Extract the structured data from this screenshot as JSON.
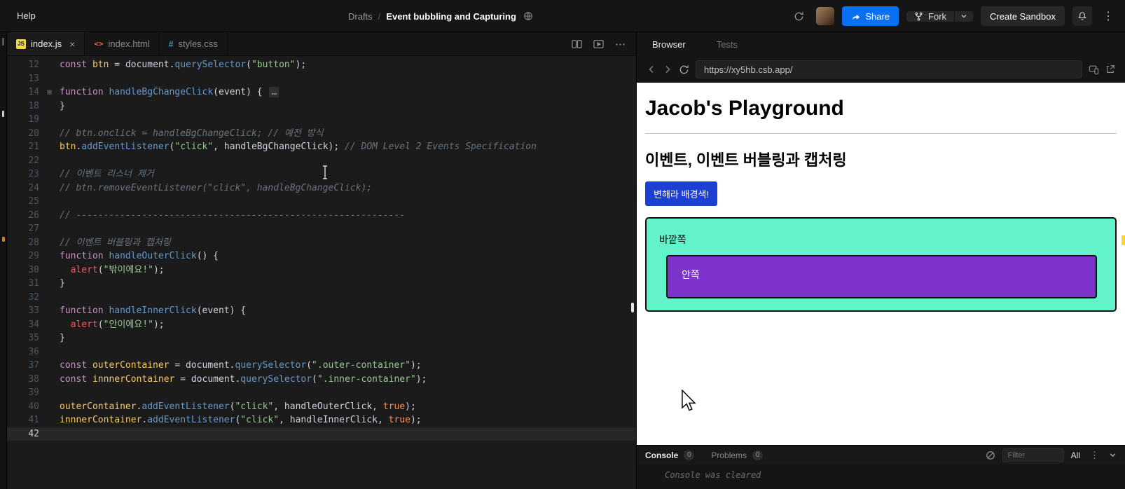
{
  "header": {
    "help_label": "Help",
    "breadcrumb": {
      "folder": "Drafts",
      "separator": "/",
      "title": "Event bubbling and Capturing"
    },
    "share_label": "Share",
    "fork_label": "Fork",
    "create_sandbox_label": "Create Sandbox"
  },
  "editor": {
    "tabs": [
      {
        "label": "index.js",
        "active": true
      },
      {
        "label": "index.html",
        "active": false
      },
      {
        "label": "styles.css",
        "active": false
      }
    ],
    "lines": [
      {
        "n": 12,
        "tokens": [
          [
            "k",
            "const"
          ],
          [
            "pl",
            " "
          ],
          [
            "v",
            "btn"
          ],
          [
            "pl",
            " = "
          ],
          [
            "pl",
            "document"
          ],
          [
            "pl",
            "."
          ],
          [
            "f",
            "querySelector"
          ],
          [
            "pl",
            "("
          ],
          [
            "s",
            "\"button\""
          ],
          [
            "pl",
            ");"
          ]
        ]
      },
      {
        "n": 13,
        "tokens": []
      },
      {
        "n": 14,
        "fold": true,
        "tokens": [
          [
            "k",
            "function"
          ],
          [
            "pl",
            " "
          ],
          [
            "f",
            "handleBgChangeClick"
          ],
          [
            "pl",
            "(event) { "
          ],
          [
            "e",
            "…"
          ]
        ]
      },
      {
        "n": 18,
        "tokens": [
          [
            "pl",
            "}"
          ]
        ]
      },
      {
        "n": 19,
        "tokens": []
      },
      {
        "n": 20,
        "tokens": [
          [
            "c",
            "// btn.onclick = handleBgChangeClick; // 예전 방식"
          ]
        ]
      },
      {
        "n": 21,
        "tokens": [
          [
            "v",
            "btn"
          ],
          [
            "pl",
            "."
          ],
          [
            "f",
            "addEventListener"
          ],
          [
            "pl",
            "("
          ],
          [
            "s",
            "\"click\""
          ],
          [
            "pl",
            ", handleBgChangeClick); "
          ],
          [
            "c",
            "// DOM Level 2 Events Specification"
          ]
        ]
      },
      {
        "n": 22,
        "tokens": []
      },
      {
        "n": 23,
        "tokens": [
          [
            "c",
            "// 이벤트 리스너 제거"
          ]
        ]
      },
      {
        "n": 24,
        "tokens": [
          [
            "c",
            "// btn.removeEventListener(\"click\", handleBgChangeClick);"
          ]
        ]
      },
      {
        "n": 25,
        "tokens": []
      },
      {
        "n": 26,
        "tokens": [
          [
            "c",
            "// ------------------------------------------------------------"
          ]
        ]
      },
      {
        "n": 27,
        "tokens": []
      },
      {
        "n": 28,
        "tokens": [
          [
            "c",
            "// 이벤트 버블링과 캡처링"
          ]
        ]
      },
      {
        "n": 29,
        "tokens": [
          [
            "k",
            "function"
          ],
          [
            "pl",
            " "
          ],
          [
            "f",
            "handleOuterClick"
          ],
          [
            "pl",
            "() {"
          ]
        ]
      },
      {
        "n": 30,
        "tokens": [
          [
            "pl",
            "  "
          ],
          [
            "b",
            "alert"
          ],
          [
            "pl",
            "("
          ],
          [
            "s",
            "\"밖이에요!\""
          ],
          [
            "pl",
            ");"
          ]
        ]
      },
      {
        "n": 31,
        "tokens": [
          [
            "pl",
            "}"
          ]
        ]
      },
      {
        "n": 32,
        "tokens": []
      },
      {
        "n": 33,
        "tokens": [
          [
            "k",
            "function"
          ],
          [
            "pl",
            " "
          ],
          [
            "f",
            "handleInnerClick"
          ],
          [
            "pl",
            "(event) {"
          ]
        ]
      },
      {
        "n": 34,
        "tokens": [
          [
            "pl",
            "  "
          ],
          [
            "b",
            "alert"
          ],
          [
            "pl",
            "("
          ],
          [
            "s",
            "\"안이에요!\""
          ],
          [
            "pl",
            ");"
          ]
        ]
      },
      {
        "n": 35,
        "tokens": [
          [
            "pl",
            "}"
          ]
        ]
      },
      {
        "n": 36,
        "tokens": []
      },
      {
        "n": 37,
        "tokens": [
          [
            "k",
            "const"
          ],
          [
            "pl",
            " "
          ],
          [
            "v",
            "outerContainer"
          ],
          [
            "pl",
            " = document."
          ],
          [
            "f",
            "querySelector"
          ],
          [
            "pl",
            "("
          ],
          [
            "s",
            "\".outer-container\""
          ],
          [
            "pl",
            ");"
          ]
        ]
      },
      {
        "n": 38,
        "tokens": [
          [
            "k",
            "const"
          ],
          [
            "pl",
            " "
          ],
          [
            "v",
            "innnerContainer"
          ],
          [
            "pl",
            " = document."
          ],
          [
            "f",
            "querySelector"
          ],
          [
            "pl",
            "("
          ],
          [
            "s",
            "\".inner-container\""
          ],
          [
            "pl",
            ");"
          ]
        ]
      },
      {
        "n": 39,
        "tokens": []
      },
      {
        "n": 40,
        "tokens": [
          [
            "v",
            "outerContainer"
          ],
          [
            "pl",
            "."
          ],
          [
            "f",
            "addEventListener"
          ],
          [
            "pl",
            "("
          ],
          [
            "s",
            "\"click\""
          ],
          [
            "pl",
            ", handleOuterClick, "
          ],
          [
            "t",
            "true"
          ],
          [
            "pl",
            ");"
          ]
        ]
      },
      {
        "n": 41,
        "tokens": [
          [
            "v",
            "innnerContainer"
          ],
          [
            "pl",
            "."
          ],
          [
            "f",
            "addEventListener"
          ],
          [
            "pl",
            "("
          ],
          [
            "s",
            "\"click\""
          ],
          [
            "pl",
            ", handleInnerClick, "
          ],
          [
            "t",
            "true"
          ],
          [
            "pl",
            ");"
          ]
        ]
      },
      {
        "n": 42,
        "active": true,
        "tokens": []
      }
    ]
  },
  "browser_panel": {
    "tabs": {
      "browser": "Browser",
      "tests": "Tests"
    },
    "url": "https://xy5hb.csb.app/"
  },
  "preview": {
    "title": "Jacob's Playground",
    "heading": "이벤트, 이벤트 버블링과 캡처링",
    "button_label": "변해라 배경색!",
    "button_style": "background:#1c3fd4;color:#ffffff",
    "outer_label": "바깥쪽",
    "outer_style": "background:#63f3cb",
    "inner_label": "안쪽",
    "inner_style": "background:#7d33c9;color:#ffffff"
  },
  "console": {
    "console_label": "Console",
    "console_count": "0",
    "problems_label": "Problems",
    "problems_count": "0",
    "filter_placeholder": "Filter",
    "all_label": "All",
    "cleared_message": "Console was cleared"
  },
  "colors": {
    "share_button": "#0971f1",
    "preview_button": "#1c3fd4",
    "outer_container": "#63f3cb",
    "inner_container": "#7d33c9"
  }
}
